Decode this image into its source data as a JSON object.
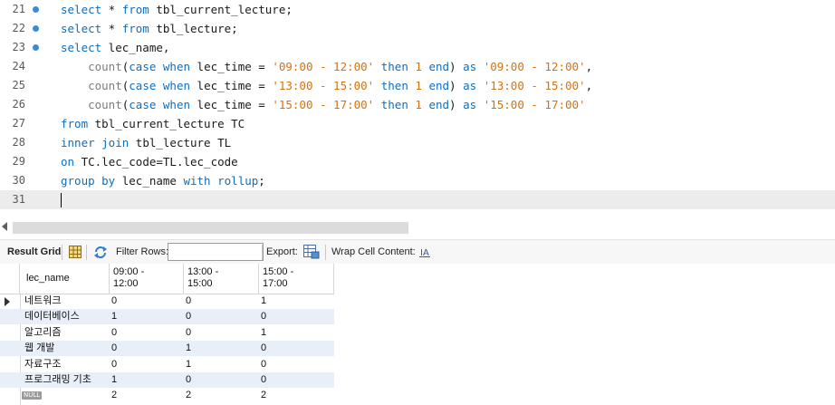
{
  "editor": {
    "lines": [
      {
        "num": "21",
        "dot": true,
        "tokens": [
          [
            "kw",
            "select"
          ],
          [
            "id",
            " * "
          ],
          [
            "kw",
            "from"
          ],
          [
            "id",
            " tbl_current_lecture;"
          ]
        ]
      },
      {
        "num": "22",
        "dot": true,
        "tokens": [
          [
            "kw",
            "select"
          ],
          [
            "id",
            " * "
          ],
          [
            "kw",
            "from"
          ],
          [
            "id",
            " tbl_lecture;"
          ]
        ]
      },
      {
        "num": "23",
        "dot": true,
        "tokens": [
          [
            "kw",
            "select"
          ],
          [
            "id",
            " lec_name,"
          ]
        ]
      },
      {
        "num": "24",
        "dot": false,
        "tokens": [
          [
            "id",
            "    "
          ],
          [
            "fn",
            "count"
          ],
          [
            "id",
            "("
          ],
          [
            "kw",
            "case when"
          ],
          [
            "id",
            " lec_time = "
          ],
          [
            "str",
            "'09:00 - 12:00'"
          ],
          [
            "id",
            " "
          ],
          [
            "kw",
            "then"
          ],
          [
            "id",
            " "
          ],
          [
            "num",
            "1"
          ],
          [
            "id",
            " "
          ],
          [
            "kw",
            "end"
          ],
          [
            "id",
            ") "
          ],
          [
            "kw",
            "as"
          ],
          [
            "id",
            " "
          ],
          [
            "str",
            "'09:00 - 12:00'"
          ],
          [
            "id",
            ","
          ]
        ]
      },
      {
        "num": "25",
        "dot": false,
        "tokens": [
          [
            "id",
            "    "
          ],
          [
            "fn",
            "count"
          ],
          [
            "id",
            "("
          ],
          [
            "kw",
            "case when"
          ],
          [
            "id",
            " lec_time = "
          ],
          [
            "str",
            "'13:00 - 15:00'"
          ],
          [
            "id",
            " "
          ],
          [
            "kw",
            "then"
          ],
          [
            "id",
            " "
          ],
          [
            "num",
            "1"
          ],
          [
            "id",
            " "
          ],
          [
            "kw",
            "end"
          ],
          [
            "id",
            ") "
          ],
          [
            "kw",
            "as"
          ],
          [
            "id",
            " "
          ],
          [
            "str",
            "'13:00 - 15:00'"
          ],
          [
            "id",
            ","
          ]
        ]
      },
      {
        "num": "26",
        "dot": false,
        "tokens": [
          [
            "id",
            "    "
          ],
          [
            "fn",
            "count"
          ],
          [
            "id",
            "("
          ],
          [
            "kw",
            "case when"
          ],
          [
            "id",
            " lec_time = "
          ],
          [
            "str",
            "'15:00 - 17:00'"
          ],
          [
            "id",
            " "
          ],
          [
            "kw",
            "then"
          ],
          [
            "id",
            " "
          ],
          [
            "num",
            "1"
          ],
          [
            "id",
            " "
          ],
          [
            "kw",
            "end"
          ],
          [
            "id",
            ") "
          ],
          [
            "kw",
            "as"
          ],
          [
            "id",
            " "
          ],
          [
            "str",
            "'15:00 - 17:00'"
          ]
        ]
      },
      {
        "num": "27",
        "dot": false,
        "tokens": [
          [
            "kw",
            "from"
          ],
          [
            "id",
            " tbl_current_lecture TC"
          ]
        ]
      },
      {
        "num": "28",
        "dot": false,
        "tokens": [
          [
            "kw",
            "inner join"
          ],
          [
            "id",
            " tbl_lecture TL"
          ]
        ]
      },
      {
        "num": "29",
        "dot": false,
        "tokens": [
          [
            "kw",
            "on"
          ],
          [
            "id",
            " TC.lec_code=TL.lec_code"
          ]
        ]
      },
      {
        "num": "30",
        "dot": false,
        "tokens": [
          [
            "kw",
            "group by"
          ],
          [
            "id",
            " lec_name "
          ],
          [
            "kw",
            "with rollup"
          ],
          [
            "id",
            ";"
          ]
        ]
      },
      {
        "num": "31",
        "dot": false,
        "current": true,
        "tokens": []
      }
    ]
  },
  "toolbar": {
    "result_grid_label": "Result Grid",
    "filter_rows_label": "Filter Rows:",
    "filter_rows_value": "",
    "export_label": "Export:",
    "wrap_cell_label": "Wrap Cell Content:"
  },
  "grid": {
    "columns": [
      "lec_name",
      "09:00 -\n12:00",
      "13:00 -\n15:00",
      "15:00 -\n17:00"
    ],
    "columns_display": {
      "c0": "lec_name",
      "c1a": "09:00 -",
      "c1b": "12:00",
      "c2a": "13:00 -",
      "c2b": "15:00",
      "c3a": "15:00 -",
      "c3b": "17:00"
    },
    "null_label": "NULL",
    "rows": [
      {
        "lec_name": "네트워크",
        "a": "0",
        "b": "0",
        "c": "1"
      },
      {
        "lec_name": "데이터베이스",
        "a": "1",
        "b": "0",
        "c": "0"
      },
      {
        "lec_name": "알고리즘",
        "a": "0",
        "b": "0",
        "c": "1"
      },
      {
        "lec_name": "웹 개발",
        "a": "0",
        "b": "1",
        "c": "0"
      },
      {
        "lec_name": "자료구조",
        "a": "0",
        "b": "1",
        "c": "0"
      },
      {
        "lec_name": "프로그래밍 기초",
        "a": "1",
        "b": "0",
        "c": "0"
      },
      {
        "lec_name": "",
        "a": "2",
        "b": "2",
        "c": "2"
      }
    ]
  },
  "colors": {
    "keyword": "#0a6fc2",
    "function": "#7d7d7d",
    "string": "#d3730c",
    "gutter_dot": "#3b8ad6",
    "alt_row": "#e8eff8"
  }
}
